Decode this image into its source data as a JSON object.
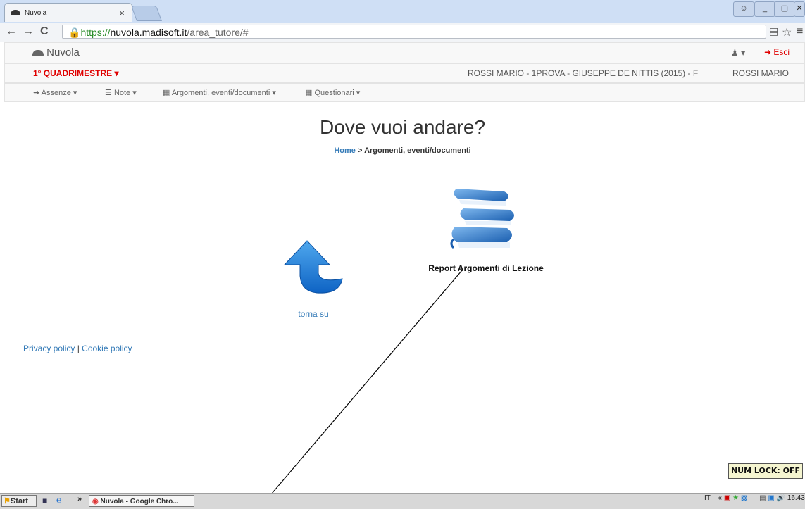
{
  "browser": {
    "tab_title": "Nuvola",
    "tab_close": "×",
    "url_scheme": "https://",
    "url_host": "nuvola.madisoft.it",
    "url_path": "/area_tutore/#",
    "window_controls": [
      "_",
      "▢",
      "✕"
    ]
  },
  "app": {
    "brand": "Nuvola",
    "logout_label": "Esci",
    "period_label": "1° QUADRIMESTRE",
    "student_info": "ROSSI MARIO - 1PROVA - GIUSEPPE DE NITTIS (2015) - F",
    "user_name": "ROSSI MARIO",
    "menu": [
      {
        "label": "Assenze"
      },
      {
        "label": "Note"
      },
      {
        "label": "Argomenti, eventi/documenti"
      },
      {
        "label": "Questionari"
      }
    ]
  },
  "main": {
    "heading": "Dove vuoi andare?",
    "breadcrumb_home": "Home",
    "breadcrumb_sep": ">",
    "breadcrumb_current": "Argomenti, eventi/documenti",
    "tile_label": "Report Argomenti di Lezione",
    "back_label": "torna su"
  },
  "footer": {
    "privacy": "Privacy policy",
    "separator": "|",
    "cookie": "Cookie policy"
  },
  "overlay": {
    "numlock": "NUM LOCK: OFF"
  },
  "taskbar": {
    "start": "Start",
    "task_item": "Nuvola - Google Chro...",
    "lang": "IT",
    "clock": "16.43"
  },
  "colors": {
    "link": "#337ab7",
    "period_red": "#e00000",
    "logout_red": "#e00000"
  }
}
